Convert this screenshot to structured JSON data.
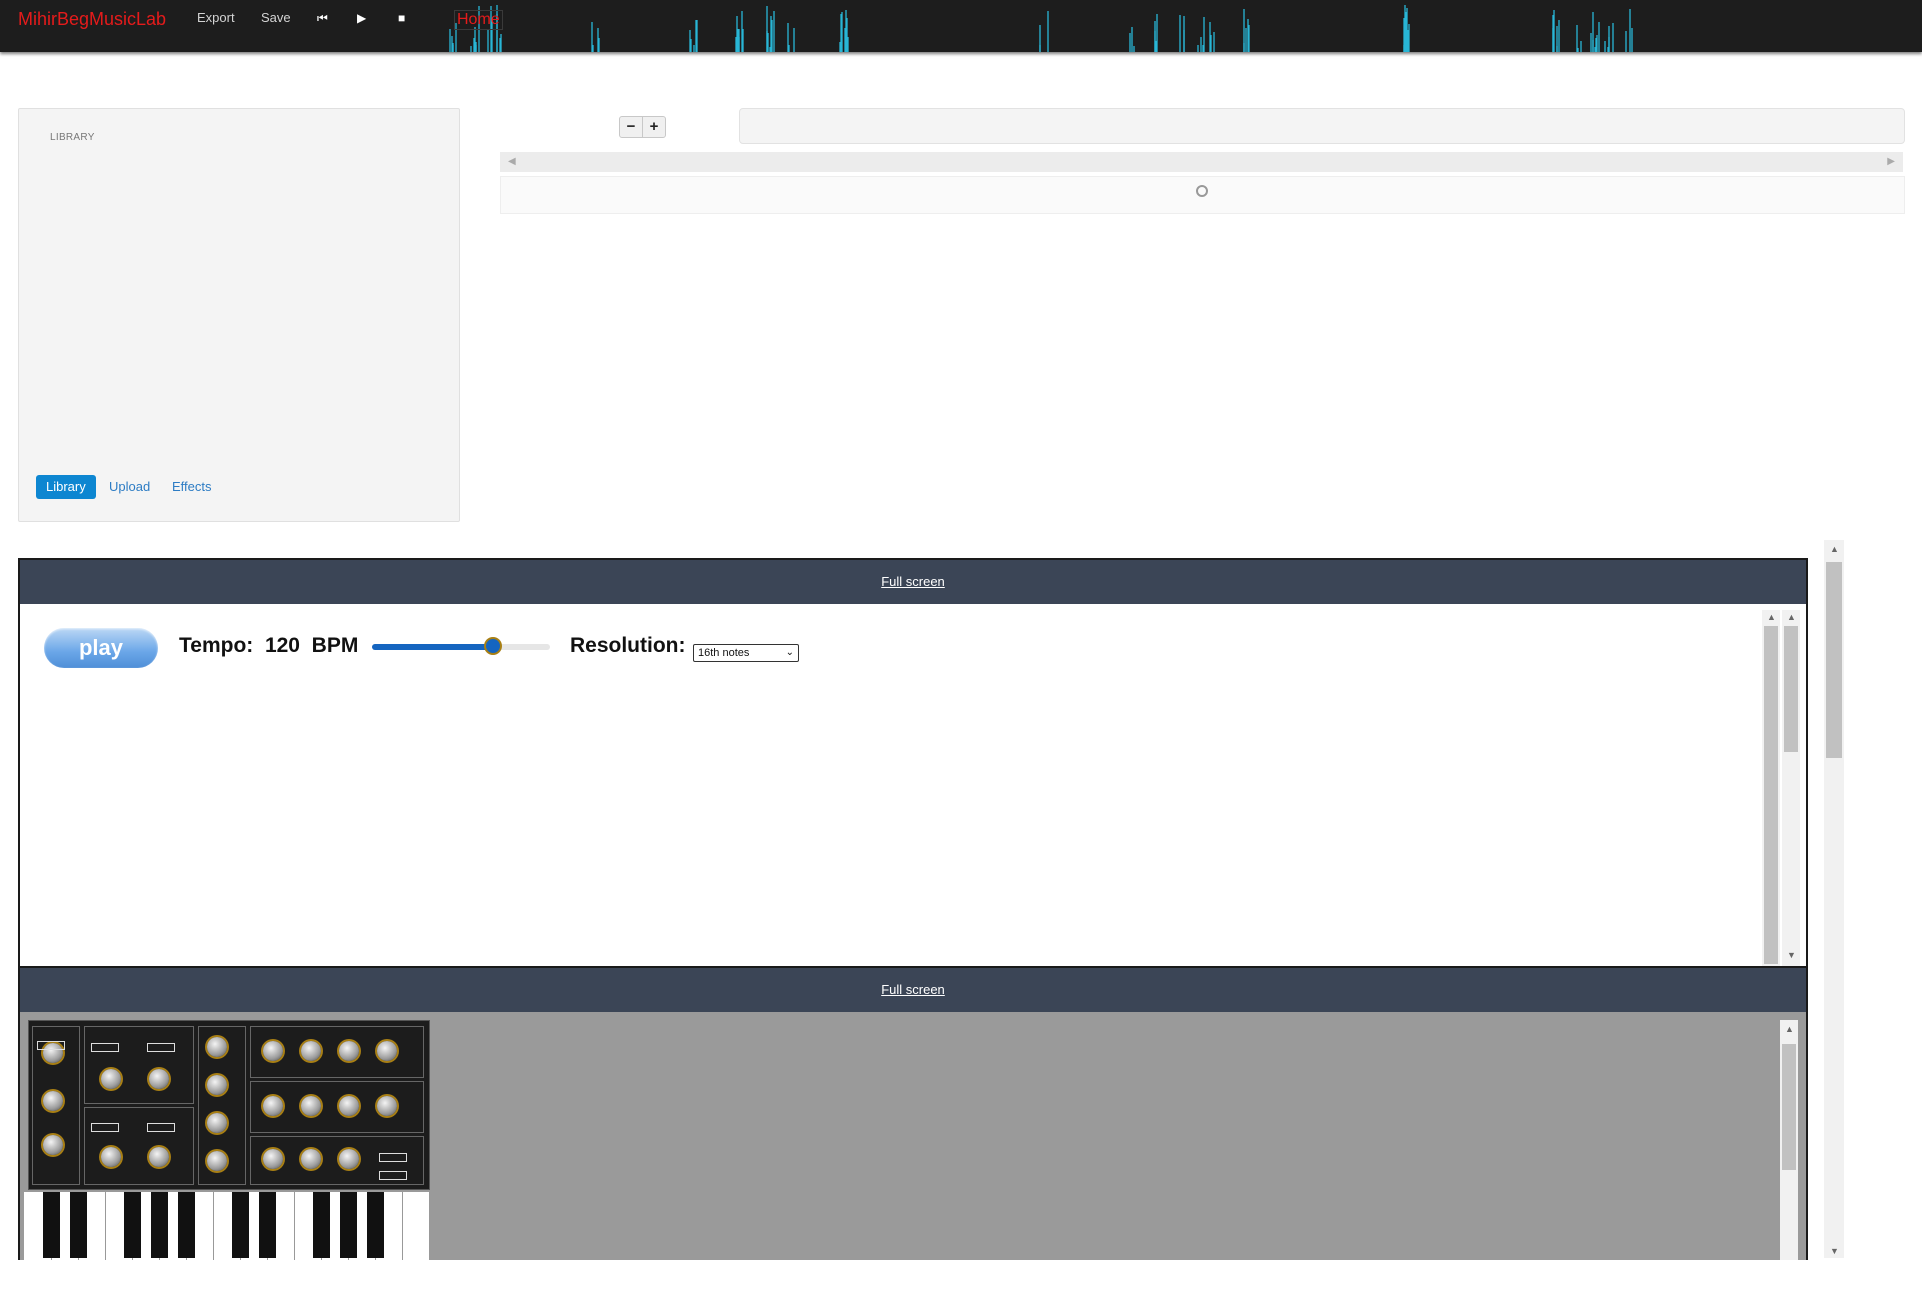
{
  "topbar": {
    "brand": "MihirBegMusicLab",
    "export_label": "Export",
    "save_label": "Save",
    "home_label": "Home",
    "icons": [
      "skip-back-icon",
      "play-icon",
      "stop-icon"
    ]
  },
  "library": {
    "title": "LIBRARY",
    "tabs": [
      {
        "label": "Library",
        "active": true
      },
      {
        "label": "Upload",
        "active": false
      },
      {
        "label": "Effects",
        "active": false
      }
    ]
  },
  "timeline": {
    "zoom_out": "−",
    "zoom_in": "+"
  },
  "sequencer_panel": {
    "fullscreen_label": "Full screen",
    "play_label": "play",
    "tempo_label": "Tempo:",
    "tempo_value": "120",
    "tempo_unit": "BPM",
    "tempo_fraction": 0.68,
    "resolution_label": "Resolution:",
    "resolution_value": "16th notes"
  },
  "synth_panel": {
    "fullscreen_label": "Full screen"
  },
  "colors": {
    "brand": "#e51b1b",
    "panel_header": "#3b4556",
    "accent": "#1565c0",
    "waveform": "#29b6d6"
  }
}
